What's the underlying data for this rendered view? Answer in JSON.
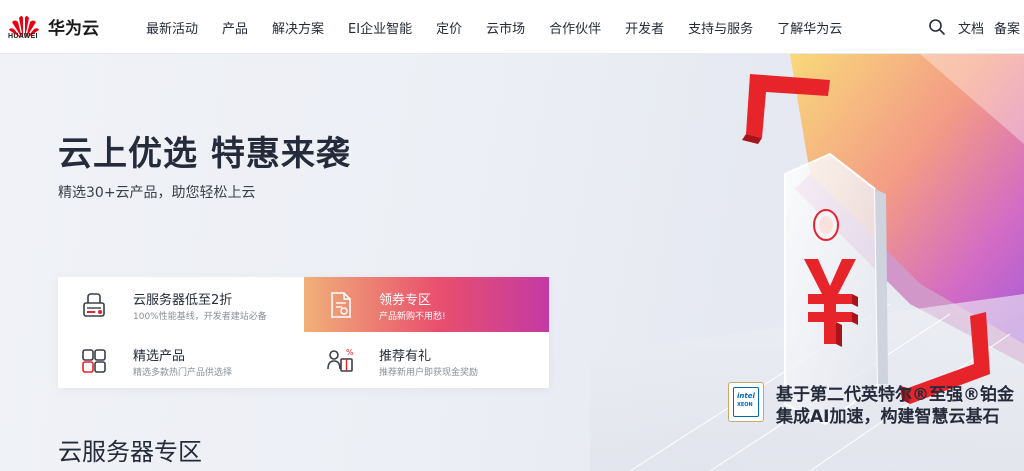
{
  "header": {
    "brand_text": "HUAWEI",
    "brand_name": "华为云",
    "nav": [
      "最新活动",
      "产品",
      "解决方案",
      "EI企业智能",
      "定价",
      "云市场",
      "合作伙伴",
      "开发者",
      "支持与服务",
      "了解华为云"
    ],
    "links": {
      "docs": "文档",
      "beian": "备案"
    }
  },
  "hero": {
    "title": "云上优选 特惠来袭",
    "subtitle": "精选30+云产品，助您轻松上云"
  },
  "promo": {
    "cards": [
      {
        "title": "云服务器低至2折",
        "desc": "100%性能基线，开发者建站必备",
        "icon": "server-icon"
      },
      {
        "title": "领券专区",
        "desc": "产品新购不用愁!",
        "icon": "coupon-icon"
      },
      {
        "title": "精选产品",
        "desc": "精选多款热门产品供选择",
        "icon": "products-icon"
      },
      {
        "title": "推荐有礼",
        "desc": "推荐新用户即获现金奖励",
        "icon": "gift-icon"
      }
    ]
  },
  "section": {
    "title": "云服务器专区"
  },
  "feature": {
    "badge_brand": "intel",
    "badge_product": "XEON",
    "line1": "基于第二代英特尔®至强®铂金",
    "line2": "集成AI加速，构建智慧云基石"
  },
  "colors": {
    "accent_gradient_start": "#f0b079",
    "accent_gradient_mid": "#e94f6d",
    "accent_gradient_end": "#c43aa4",
    "logo_red": "#e60012"
  }
}
